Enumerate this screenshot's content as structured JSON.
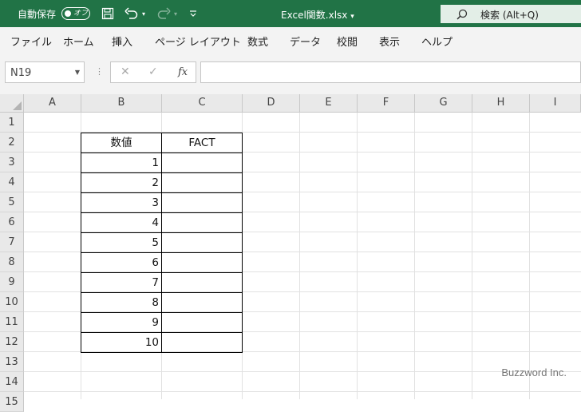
{
  "titlebar": {
    "autosave_label": "自動保存",
    "autosave_toggle": "オフ",
    "filename": "Excel関数.xlsx",
    "filename_caret": "▾",
    "search_text": "検索 (Alt+Q)",
    "accent": "#217346"
  },
  "ribbon": {
    "tabs": [
      "ファイル",
      "ホーム",
      "挿入",
      "ページ レイアウト",
      "数式",
      "データ",
      "校閲",
      "表示",
      "ヘルプ"
    ]
  },
  "formula_bar": {
    "name_box": "N19",
    "cancel": "✕",
    "enter": "✓",
    "fx": "fx",
    "content": ""
  },
  "sheet": {
    "columns": [
      "A",
      "B",
      "C",
      "D",
      "E",
      "F",
      "G",
      "H",
      "I"
    ],
    "rows": [
      "1",
      "2",
      "3",
      "4",
      "5",
      "6",
      "7",
      "8",
      "9",
      "10",
      "11",
      "12",
      "13",
      "14",
      "15"
    ],
    "table": {
      "header_b": "数値",
      "header_c": "FACT",
      "values": [
        "1",
        "2",
        "3",
        "4",
        "5",
        "6",
        "7",
        "8",
        "9",
        "10"
      ]
    }
  },
  "watermark": "Buzzword Inc."
}
